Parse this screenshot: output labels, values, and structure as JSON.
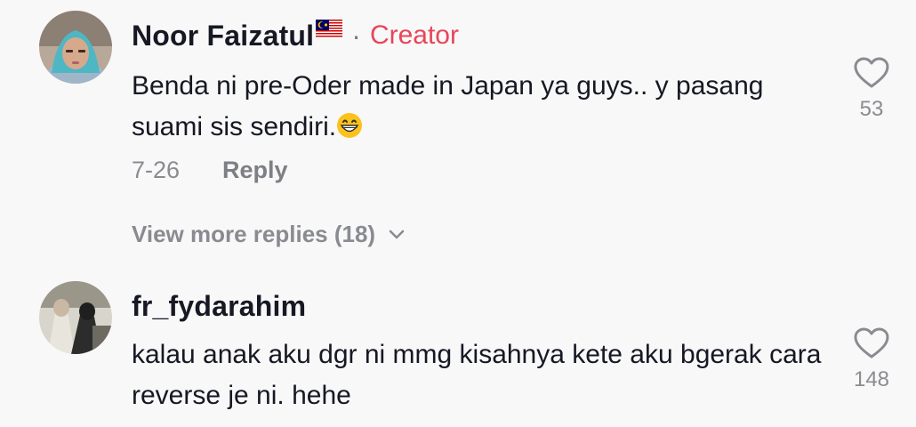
{
  "comments": [
    {
      "username": "Noor Faizatul",
      "badge_separator": "·",
      "badge": "Creator",
      "text": "Benda ni pre-Oder made in Japan ya guys.. y pasang suami sis sendiri.",
      "emoji_icon": "grinning-face-icon",
      "date": "7-26",
      "reply_label": "Reply",
      "likes": "53",
      "flag_icon": "malaysia-flag-icon"
    },
    {
      "username": "fr_fydarahim",
      "text": "kalau anak aku dgr ni mmg kisahnya kete aku bgerak cara reverse je ni. hehe",
      "likes": "148"
    }
  ],
  "view_more_replies": "View more replies (18)",
  "colors": {
    "background": "#f8f8f8",
    "creator_badge": "#e8455a",
    "text_primary": "#161823",
    "text_secondary": "#8a8b91"
  }
}
